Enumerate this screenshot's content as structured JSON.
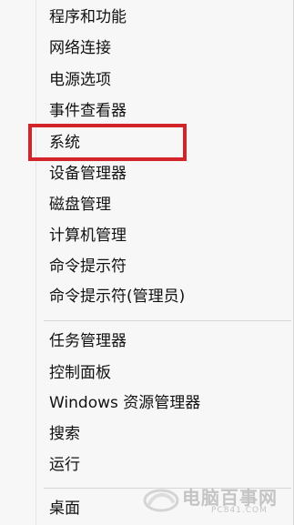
{
  "menu": {
    "items": [
      {
        "label": "程序和功能"
      },
      {
        "label": "网络连接"
      },
      {
        "label": "电源选项"
      },
      {
        "label": "事件查看器"
      },
      {
        "label": "系统"
      },
      {
        "label": "设备管理器"
      },
      {
        "label": "磁盘管理"
      },
      {
        "label": "计算机管理"
      },
      {
        "label": "命令提示符"
      },
      {
        "label": "命令提示符(管理员)"
      },
      {
        "label": "任务管理器"
      },
      {
        "label": "控制面板"
      },
      {
        "label": "Windows 资源管理器"
      },
      {
        "label": "搜索"
      },
      {
        "label": "运行"
      },
      {
        "label": "桌面"
      }
    ],
    "highlighted_item": "系统",
    "highlight_color": "#d3242a"
  },
  "watermark": {
    "text": "电脑百事网",
    "subtext": "PC841.COM"
  }
}
